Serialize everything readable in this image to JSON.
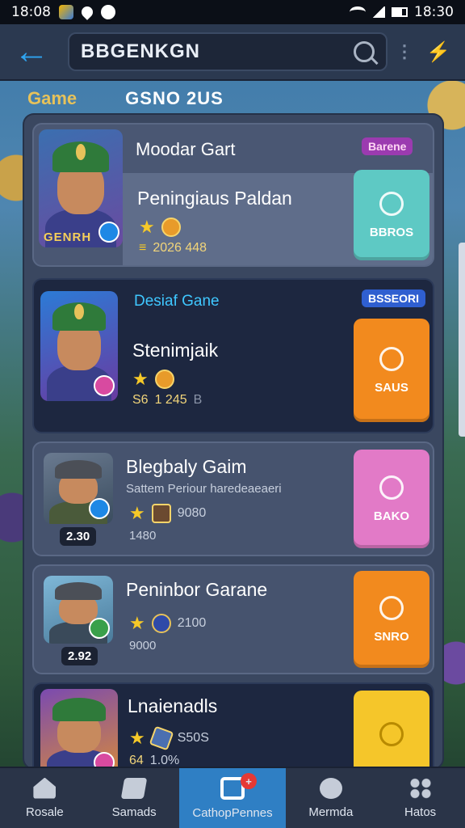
{
  "status_bar": {
    "time": "18:08",
    "right_time": "18:30",
    "icons": [
      "gallery-icon",
      "location-icon",
      "camera-icon",
      "wifi-icon",
      "signal-icon",
      "battery-icon"
    ]
  },
  "header": {
    "search_value": "BBGENKGN",
    "search_icon": "search-icon",
    "menu_icon": "more-dots-icon",
    "bolt_icon": "bolt-icon"
  },
  "section": {
    "game_label": "Game",
    "title": "GSNO 2US"
  },
  "cards": [
    {
      "tag": "Moodar Gart",
      "badge": "Barene",
      "title": "Peningiaus Paldan",
      "meta_value": "2026 448",
      "avatar_banner": "GENRH",
      "button_label": "BBROS",
      "button_color": "#5ec9c4"
    },
    {
      "tag": "Desiaf Gane",
      "badge": "BSSEORI",
      "title": "Stenimjaik",
      "meta_prefix": "S6",
      "meta_value": "1 245",
      "meta_suffix": "B",
      "button_label": "SAUS",
      "button_color": "#f28a1e"
    },
    {
      "title": "Blegbaly Gaim",
      "description": "Sattem Periour haredeaeaeri",
      "avatar_number": "2.30",
      "meta_value": "9080",
      "meta_secondary": "1480",
      "button_label": "BAKO",
      "button_color": "#e27ac7"
    },
    {
      "title": "Peninbor Garane",
      "avatar_number": "2.92",
      "meta_value": "2100",
      "meta_secondary": "9000",
      "button_label": "SNRO",
      "button_color": "#f28a1e"
    },
    {
      "title": "Lnaienadls",
      "meta_value": "S50S",
      "meta_secondary": "1.0%",
      "meta_prefix": "64",
      "button_label": "",
      "button_color": "#f5c62a"
    }
  ],
  "bottom_nav": [
    {
      "label": "Rosale",
      "icon": "home-icon"
    },
    {
      "label": "Samads",
      "icon": "games-icon"
    },
    {
      "label": "CathopPennes",
      "icon": "square-icon",
      "badge": "+"
    },
    {
      "label": "Mermda",
      "icon": "camera-icon"
    },
    {
      "label": "Hatos",
      "icon": "grid-icon"
    }
  ]
}
